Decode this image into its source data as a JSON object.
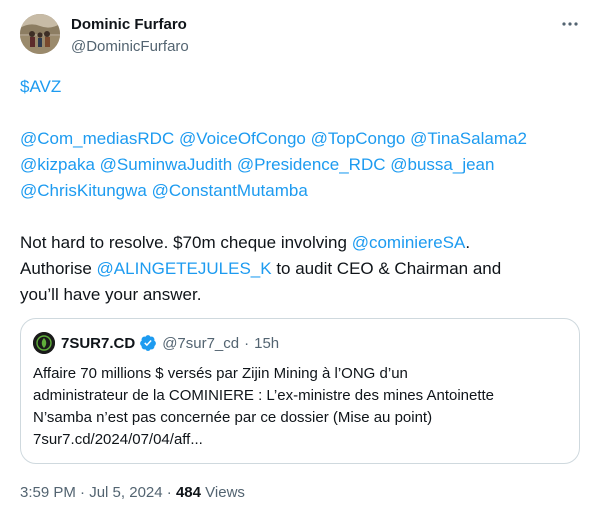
{
  "author": {
    "display_name": "Dominic Furfaro",
    "handle": "@DominicFurfaro"
  },
  "tweet": {
    "cashtag": "$AVZ",
    "mentions_line1": [
      "@Com_mediasRDC",
      "@VoiceOfCongo",
      "@TopCongo",
      "@TinaSalama2"
    ],
    "mentions_line2": [
      "@kizpaka",
      "@SuminwaJudith",
      "@Presidence_RDC",
      "@bussa_jean"
    ],
    "mentions_line3": [
      "@ChrisKitungwa",
      "@ConstantMutamba"
    ],
    "body": {
      "l1_text": "Not hard to resolve. $70m cheque involving ",
      "l1_mention": "@cominiereSA",
      "l1_end": ".",
      "l2_text": "Authorise ",
      "l2_mention": "@ALINGETEJULES_K",
      "l2_end": " to audit CEO & Chairman and",
      "l3_text": "you’ll have your answer."
    }
  },
  "quote": {
    "name": "7SUR7.CD",
    "handle": "@7sur7_cd",
    "separator": "·",
    "time": "15h",
    "lines": [
      "Affaire 70 millions $ versés par Zijin Mining à l’ONG d’un",
      "administrateur de la COMINIERE : L’ex-ministre des mines Antoinette",
      "N’samba n’est pas concernée par ce dossier (Mise au point)",
      "7sur7.cd/2024/07/04/aff..."
    ]
  },
  "footer": {
    "time": "3:59 PM",
    "sep1": "·",
    "date": "Jul 5, 2024",
    "sep2": "·",
    "views_count": "484",
    "views_label": "Views"
  },
  "colors": {
    "link": "#1d9bf0",
    "muted": "#536471",
    "text": "#0f1419",
    "border": "#cfd9de",
    "verified": "#1d9bf0"
  },
  "icons": {
    "more": "more-dots-icon",
    "verified": "verified-badge-icon"
  }
}
